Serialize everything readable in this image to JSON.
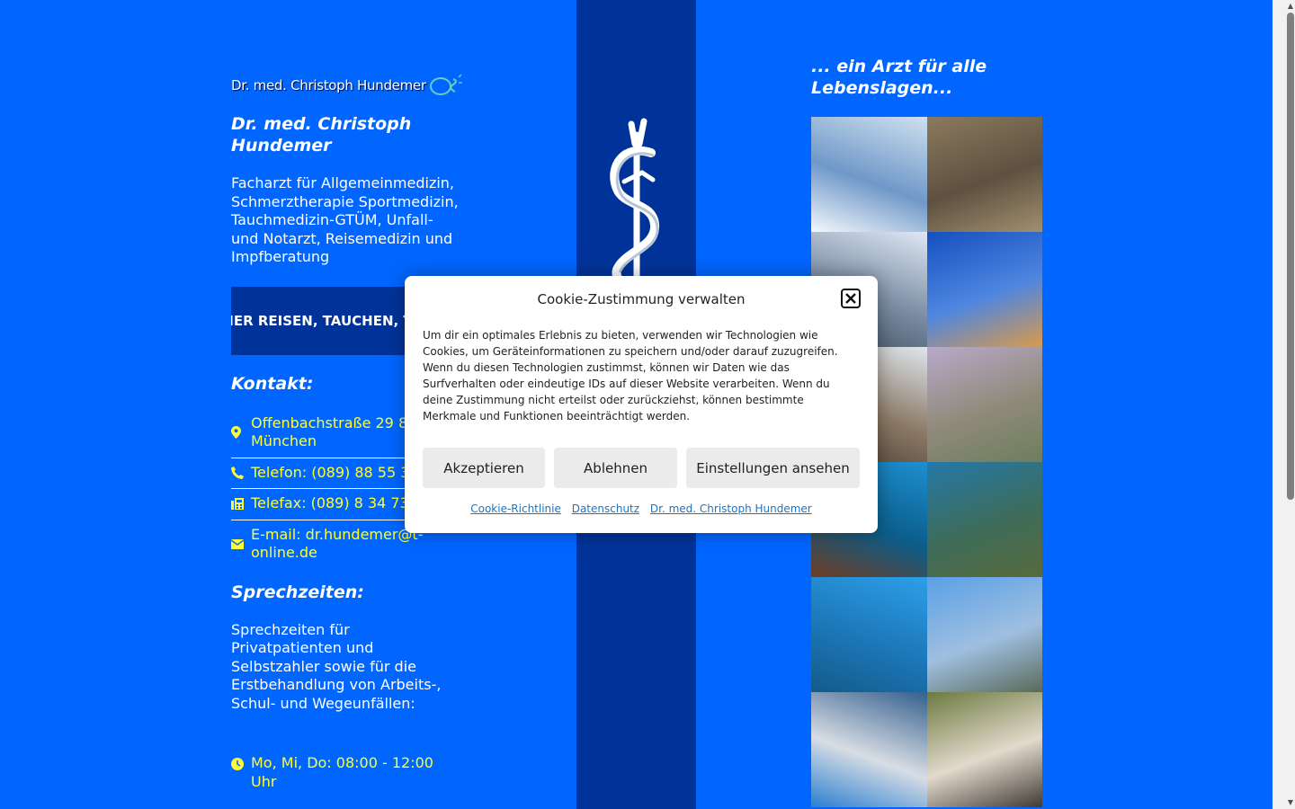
{
  "logo": {
    "text": "Dr. med. Christoph Hundemer"
  },
  "profile": {
    "name": "Dr. med. Christoph Hundemer",
    "specialties": "Facharzt für Allgemeinmedizin, Schmerztherapie Sportmedizin, Tauchmedizin-GTÜM, Unfall- und Notarzt, Reisemedizin und Impfberatung"
  },
  "cta": {
    "label": "SICHER REISEN, TAUCHEN, TRAINIEREN"
  },
  "contact": {
    "heading": "Kontakt:",
    "items": [
      {
        "icon": "map-pin-icon",
        "text": "Offenbachstraße 29 81245 München"
      },
      {
        "icon": "phone-icon",
        "text": "Telefon: (089) 88 55 36"
      },
      {
        "icon": "fax-icon",
        "text": "Telefax: (089) 8 34 73 03"
      },
      {
        "icon": "envelope-icon",
        "text": "E-mail: dr.hundemer@t-online.de"
      }
    ]
  },
  "hours": {
    "heading": "Sprechzeiten:",
    "description": "Sprechzeiten für Privatpatienten und Selbstzahler sowie für die Erstbehandlung von Arbeits-, Schul- und Wegeunfällen:",
    "line1": "Mo, Mi, Do: 08:00 - 12:00 Uhr"
  },
  "tagline": "... ein Arzt für alle Lebenslagen...",
  "gallery": [
    {
      "name": "photo-skiing",
      "colors": [
        "#cfe0f0",
        "#6f98c8",
        "#f4f8fc"
      ]
    },
    {
      "name": "photo-climbing",
      "colors": [
        "#8a7a5e",
        "#5e5140",
        "#a09070"
      ]
    },
    {
      "name": "photo-paragliding",
      "colors": [
        "#dfe8f4",
        "#7b8da4",
        "#3d4f5e"
      ]
    },
    {
      "name": "photo-dunes",
      "colors": [
        "#1450c0",
        "#4f86e0",
        "#d99a4a"
      ]
    },
    {
      "name": "photo-mountain-summit",
      "colors": [
        "#dfe6ee",
        "#8b7a66",
        "#4a3e32"
      ]
    },
    {
      "name": "photo-skydiving",
      "colors": [
        "#b9a9c9",
        "#8f8a7a",
        "#6d7e5d"
      ]
    },
    {
      "name": "photo-diving-lionfish",
      "colors": [
        "#1e8fd0",
        "#0b5d8a",
        "#6e3c22"
      ]
    },
    {
      "name": "photo-diving-reef",
      "colors": [
        "#2478a8",
        "#3e6c5a",
        "#586a3c"
      ]
    },
    {
      "name": "photo-diver-blue",
      "colors": [
        "#2d9fe8",
        "#1c77b8",
        "#145a8a"
      ]
    },
    {
      "name": "photo-summit-cross",
      "colors": [
        "#5aa0e6",
        "#9fbfe0",
        "#5a6a5a"
      ]
    },
    {
      "name": "photo-boat",
      "colors": [
        "#345f8e",
        "#d8dde4",
        "#2a7fd0"
      ]
    },
    {
      "name": "photo-group",
      "colors": [
        "#6b7a3e",
        "#e2d9cc",
        "#403a34"
      ]
    }
  ],
  "cookie": {
    "title": "Cookie-Zustimmung verwalten",
    "body": "Um dir ein optimales Erlebnis zu bieten, verwenden wir Technologien wie Cookies, um Geräteinformationen zu speichern und/oder darauf zuzugreifen. Wenn du diesen Technologien zustimmst, können wir Daten wie das Surfverhalten oder eindeutige IDs auf dieser Website verarbeiten. Wenn du deine Zustimmung nicht erteilst oder zurückziehst, können bestimmte Merkmale und Funktionen beeinträchtigt werden.",
    "accept": "Akzeptieren",
    "deny": "Ablehnen",
    "settings": "Einstellungen ansehen",
    "links": [
      "Cookie-Richtlinie",
      "Datenschutz",
      "Dr. med. Christoph Hundemer"
    ]
  },
  "colors": {
    "background": "#0066ff",
    "band": "#003399",
    "link_yellow": "#ffff33"
  }
}
